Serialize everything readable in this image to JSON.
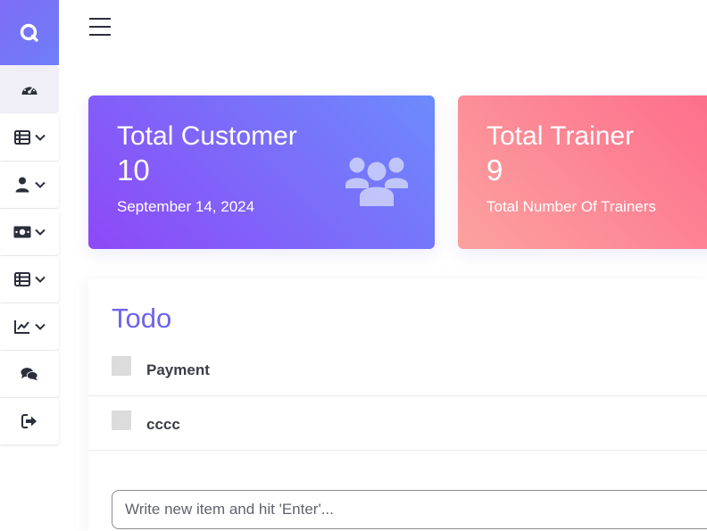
{
  "sidebar": {
    "brand_icon": "search-logo-icon",
    "items": [
      {
        "icon": "dashboard-icon",
        "active": true,
        "has_dropdown": false
      },
      {
        "icon": "table-icon",
        "active": false,
        "has_dropdown": true
      },
      {
        "icon": "user-icon",
        "active": false,
        "has_dropdown": true
      },
      {
        "icon": "money-icon",
        "active": false,
        "has_dropdown": true
      },
      {
        "icon": "table-icon",
        "active": false,
        "has_dropdown": true
      },
      {
        "icon": "chart-line-icon",
        "active": false,
        "has_dropdown": true
      },
      {
        "icon": "comments-icon",
        "active": false,
        "has_dropdown": false
      },
      {
        "icon": "logout-icon",
        "active": false,
        "has_dropdown": false
      }
    ]
  },
  "cards": {
    "customer": {
      "title": "Total Customer",
      "value": "10",
      "subtitle": "September 14, 2024",
      "icon": "users-icon"
    },
    "trainer": {
      "title": "Total Trainer",
      "value": "9",
      "subtitle": "Total Number Of Trainers"
    }
  },
  "todo": {
    "title": "Todo",
    "items": [
      {
        "label": "Payment",
        "checked": false
      },
      {
        "label": "cccc",
        "checked": false
      }
    ],
    "input_placeholder": "Write new item and hit 'Enter'..."
  },
  "colors": {
    "accent": "#6e63f0",
    "customer_card_start": "#8e48f7",
    "customer_card_end": "#6c8bfc",
    "trainer_card_start": "#fca2a0",
    "trainer_card_end": "#fd6c8a"
  }
}
